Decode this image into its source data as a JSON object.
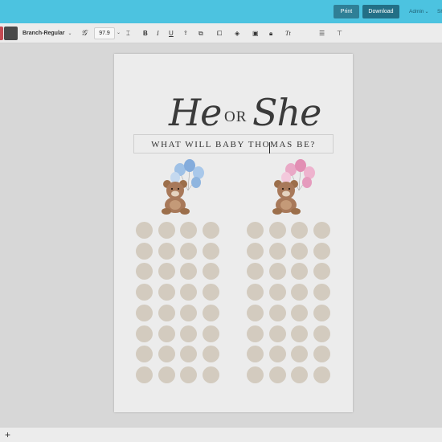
{
  "header": {
    "print_label": "Print",
    "download_label": "Download",
    "user_label": "Admin",
    "share_label": "Sh"
  },
  "toolbar": {
    "font_name": "Branch-Regular",
    "font_size": "97.9",
    "icons": [
      "font-style-icon",
      "text-height-icon",
      "bold-icon",
      "italic-icon",
      "underline-icon",
      "uppercase-icon",
      "resize-icon",
      "duplicate-icon",
      "layers-icon",
      "arrange-icon",
      "lock-icon",
      "text-transform-icon",
      "line-spacing-icon",
      "align-icon"
    ],
    "colors": {
      "primary": "#c54a52",
      "secondary": "#4a4a4a"
    }
  },
  "canvas": {
    "title_he": "He",
    "title_or": "OR",
    "title_she": "She",
    "subtitle": "WHAT WILL BABY THOMAS BE?",
    "left_bear": "bear-with-blue-balloons",
    "right_bear": "bear-with-pink-balloons",
    "dot_columns_per_side": 4,
    "dot_rows": 8,
    "dot_color": "#d3cbbf"
  },
  "footer": {
    "add_label": "+"
  },
  "theme": {
    "accent": "#4cc3e0",
    "download_button": "#236f86"
  }
}
